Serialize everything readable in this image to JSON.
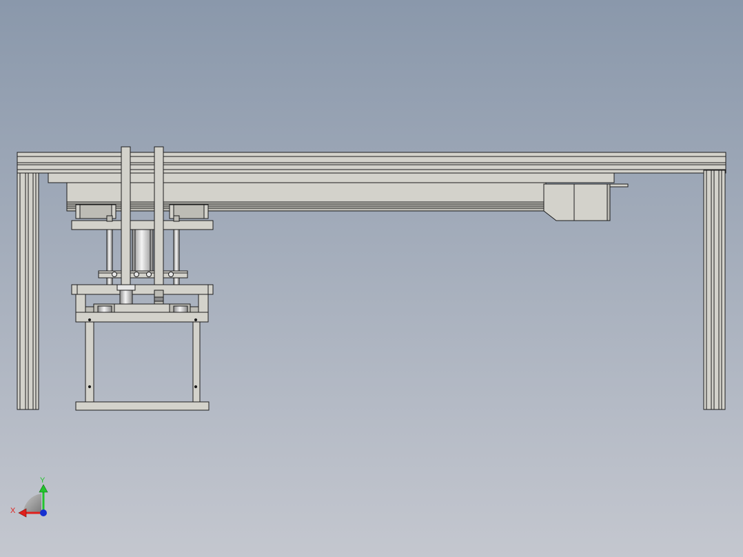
{
  "viewport": {
    "background_top": "#8a98ab",
    "background_bottom": "#c4c7cf"
  },
  "model": {
    "part_fill": "#d3d2cb",
    "part_shade": "#bdbcb5",
    "edge_color": "#1c1c1c",
    "shaft_light": "#f2f2f2",
    "shaft_dark": "#8c8c8c"
  },
  "triad": {
    "x_label": "X",
    "y_label": "Y",
    "x_color": "#e0201c",
    "y_color": "#22c42c",
    "z_color": "#1530d0",
    "plane_color": "#9a9a9a"
  }
}
